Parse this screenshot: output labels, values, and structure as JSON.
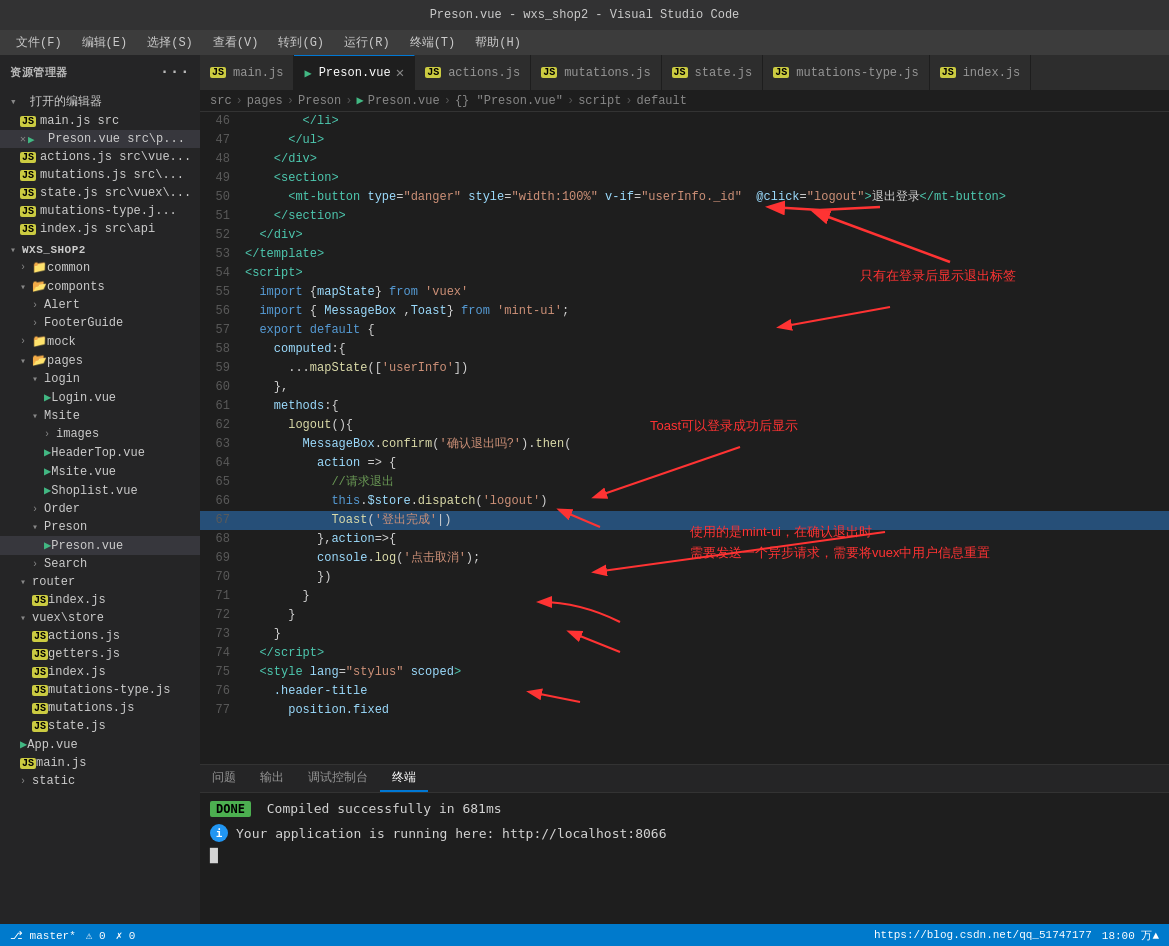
{
  "titlebar": {
    "text": "Preson.vue - wxs_shop2 - Visual Studio Code"
  },
  "menubar": {
    "items": [
      "文件(F)",
      "编辑(E)",
      "选择(S)",
      "查看(V)",
      "转到(G)",
      "运行(R)",
      "终端(T)",
      "帮助(H)"
    ]
  },
  "sidebar": {
    "header": "资源管理器",
    "sections": {
      "open_editors_label": "打开的编辑器",
      "open_editors": [
        {
          "type": "js",
          "name": "main.js",
          "path": "src"
        },
        {
          "type": "vue",
          "name": "Preson.vue",
          "path": "src\\p...",
          "active": true,
          "modified": true
        },
        {
          "type": "js",
          "name": "actions.js",
          "path": "src\\vue..."
        },
        {
          "type": "js",
          "name": "mutations.js",
          "path": "src\\..."
        },
        {
          "type": "js",
          "name": "state.js",
          "path": "src\\vuex\\..."
        },
        {
          "type": "js",
          "name": "mutations-type.j...",
          "path": ""
        },
        {
          "type": "js",
          "name": "index.js",
          "path": "src\\api"
        }
      ],
      "project_label": "WXS_SHOP2",
      "tree": [
        {
          "indent": 1,
          "type": "folder",
          "name": "common",
          "open": false
        },
        {
          "indent": 1,
          "type": "folder",
          "name": "componts",
          "open": true
        },
        {
          "indent": 2,
          "type": "folder",
          "name": "Alert",
          "open": false
        },
        {
          "indent": 2,
          "type": "folder",
          "name": "FooterGuide",
          "open": false
        },
        {
          "indent": 1,
          "type": "folder",
          "name": "mock",
          "open": false
        },
        {
          "indent": 1,
          "type": "folder",
          "name": "pages",
          "open": true
        },
        {
          "indent": 2,
          "type": "folder",
          "name": "login",
          "open": true
        },
        {
          "indent": 3,
          "type": "vue",
          "name": "Login.vue"
        },
        {
          "indent": 2,
          "type": "folder",
          "name": "Msite",
          "open": true
        },
        {
          "indent": 3,
          "type": "folder",
          "name": "images",
          "open": false
        },
        {
          "indent": 3,
          "type": "vue",
          "name": "HeaderTop.vue"
        },
        {
          "indent": 3,
          "type": "vue",
          "name": "Msite.vue"
        },
        {
          "indent": 3,
          "type": "vue",
          "name": "Shoplist.vue"
        },
        {
          "indent": 2,
          "type": "folder",
          "name": "Order",
          "open": false
        },
        {
          "indent": 2,
          "type": "folder",
          "name": "Preson",
          "open": true
        },
        {
          "indent": 3,
          "type": "vue",
          "name": "Preson.vue",
          "active": true
        },
        {
          "indent": 2,
          "type": "folder",
          "name": "Search",
          "open": false
        },
        {
          "indent": 1,
          "type": "folder",
          "name": "router",
          "open": true
        },
        {
          "indent": 2,
          "type": "js",
          "name": "index.js"
        },
        {
          "indent": 1,
          "type": "folder",
          "name": "vuex\\store",
          "open": true
        },
        {
          "indent": 2,
          "type": "js",
          "name": "actions.js"
        },
        {
          "indent": 2,
          "type": "js",
          "name": "getters.js"
        },
        {
          "indent": 2,
          "type": "js",
          "name": "index.js"
        },
        {
          "indent": 2,
          "type": "js",
          "name": "mutations-type.js"
        },
        {
          "indent": 2,
          "type": "js",
          "name": "mutations.js"
        },
        {
          "indent": 2,
          "type": "js",
          "name": "state.js"
        },
        {
          "indent": 1,
          "type": "vue",
          "name": "App.vue"
        },
        {
          "indent": 1,
          "type": "js",
          "name": "main.js"
        },
        {
          "indent": 1,
          "type": "folder",
          "name": "static",
          "open": false
        }
      ]
    }
  },
  "tabs": [
    {
      "label": "main.js",
      "type": "js",
      "active": false
    },
    {
      "label": "Preson.vue",
      "type": "vue",
      "active": true,
      "modified": false
    },
    {
      "label": "actions.js",
      "type": "js",
      "active": false
    },
    {
      "label": "mutations.js",
      "type": "js",
      "active": false
    },
    {
      "label": "state.js",
      "type": "js",
      "active": false
    },
    {
      "label": "mutations-type.js",
      "type": "js",
      "active": false
    },
    {
      "label": "index.js",
      "type": "js",
      "active": false
    }
  ],
  "breadcrumb": {
    "parts": [
      "src",
      "pages",
      "Preson",
      "Preson.vue",
      "{} \"Preson.vue\"",
      "script",
      "default"
    ]
  },
  "code": {
    "lines": [
      {
        "num": 46,
        "content": "        <\\/li>"
      },
      {
        "num": 47,
        "content": "      <\\/ul>"
      },
      {
        "num": 48,
        "content": "    <\\/div>"
      },
      {
        "num": 49,
        "content": "    <section>"
      },
      {
        "num": 50,
        "content": "      <mt-button type=\"danger\" style=\"width:100%\" v-if=\"userInfo._id\"  @click=\"logout\">退出登录<\\/mt-button>"
      },
      {
        "num": 51,
        "content": "    <\\/section>"
      },
      {
        "num": 52,
        "content": "  <\\/div>"
      },
      {
        "num": 53,
        "content": "<\\/template>"
      },
      {
        "num": 54,
        "content": "<script>"
      },
      {
        "num": 55,
        "content": "  import {mapState} from 'vuex'"
      },
      {
        "num": 56,
        "content": "  import { MessageBox ,Toast} from 'mint-ui';"
      },
      {
        "num": 57,
        "content": "  export default {"
      },
      {
        "num": 58,
        "content": "    computed:{"
      },
      {
        "num": 59,
        "content": "      ...mapState(['userInfo'])"
      },
      {
        "num": 60,
        "content": "    },"
      },
      {
        "num": 61,
        "content": "    methods:{"
      },
      {
        "num": 62,
        "content": "      logout(){"
      },
      {
        "num": 63,
        "content": "        MessageBox.confirm('确认退出吗?').then("
      },
      {
        "num": 64,
        "content": "          action => {"
      },
      {
        "num": 65,
        "content": "            //请求退出"
      },
      {
        "num": 66,
        "content": "            this.$store.dispatch('logout')"
      },
      {
        "num": 67,
        "content": "            Toast('登出完成')"
      },
      {
        "num": 68,
        "content": "          },action=>{"
      },
      {
        "num": 69,
        "content": "          console.log('点击取消');"
      },
      {
        "num": 70,
        "content": "          })"
      },
      {
        "num": 71,
        "content": "        }"
      },
      {
        "num": 72,
        "content": "      }"
      },
      {
        "num": 73,
        "content": "    }"
      },
      {
        "num": 74,
        "content": "  <\\/script>"
      },
      {
        "num": 75,
        "content": "  <style lang=\"stylus\" scoped>"
      },
      {
        "num": 76,
        "content": "    .header-title"
      },
      {
        "num": 77,
        "content": "      position.fixed"
      }
    ]
  },
  "panel": {
    "tabs": [
      "问题",
      "输出",
      "调试控制台",
      "终端"
    ],
    "active_tab": "终端",
    "terminal_lines": [
      {
        "type": "done",
        "text": "Compiled successfully in 681ms"
      },
      {
        "type": "info",
        "text": "Your application is running here: http://localhost:8066"
      }
    ]
  },
  "statusbar": {
    "left": [
      "master*",
      "⚠ 0",
      "✗ 0"
    ],
    "right": [
      "https://blog.csdn.net/qq_51747177",
      "18:00 万▲"
    ]
  },
  "annotations": [
    {
      "id": "ann1",
      "text": "只有在登录后显示退出标签"
    },
    {
      "id": "ann2",
      "text": "Toast可以登录成功后显示"
    },
    {
      "id": "ann3",
      "text": "使用的是mint-ui，在确认退出时\n需要发送一个异步请求，需要将vuex中用户信息重置"
    }
  ]
}
